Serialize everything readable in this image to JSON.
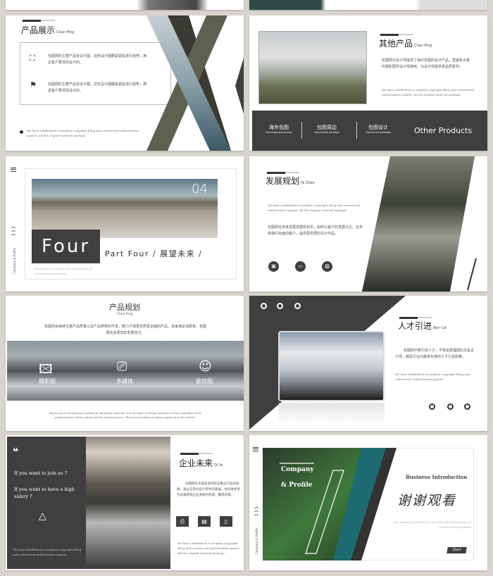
{
  "slides": {
    "s1": {
      "title": "产品展示",
      "sub": "Chan Ping",
      "item1": "包图网的主要产品有设计图，这些设计图都紧紧贴流行趋势，满足客户要求而设计的。",
      "item2": "包图网的主要产品有设计图，这些设计图都紧紧贴流行趋势，满足客户要求而设计的。",
      "footer": "We have established a complete copyright filing and commercial authorization system. All the original material package"
    },
    "s2": {
      "title": "其他产品",
      "sub": "Chan Ping",
      "body": "包图网为设计师提供了海外包图的设计产品，里面有大量的摄影图供设计师使用，为设计师提供高品质素材。",
      "footer": "We have established a complete copyright filing and commercial authorization system. All the original material package",
      "tabs": [
        {
          "label": "海外包图",
          "sub": "Sea outsourcing map"
        },
        {
          "label": "包图周边",
          "sub": "Around the package"
        },
        {
          "label": "包图设计",
          "sub": "Around the package"
        }
      ],
      "other": "Other Products"
    },
    "s3": {
      "num": "04",
      "big": "Four",
      "part": "Part Four / 展望未来 /",
      "intro": "Introduction includes the introduction of commercial promotion",
      "side": "Company & Profile"
    },
    "s4": {
      "title": "发展规划",
      "sub": "Fa Zhan",
      "footer": "We have established a complete copyright filing and commercial authorization system. All the original material package",
      "body": "包图网在未来发展发展规划中，始终以客户的发展为主，在未来我们会面向客户，提供更优质的设计作品。"
    },
    "s5": {
      "title": "产品规划",
      "sub": "Chan Ping",
      "body": "包图网会继续注重产品质量以及产品种类的开发，致力于做更优质更全面的产品，未来满足消费者，包图网还会更加的发展自己。",
      "icons": [
        "摄影图",
        "多媒体",
        "装饰图"
      ],
      "footer": "Ibaotu.com is a professional website for designing materials. It is the leader of design websites in China regardless of the professionalism of the website and the activity of users. There are countless members registered on the website."
    },
    "s6": {
      "title": "人才引进",
      "sub": "Ren Cai",
      "body": "包图网不断引进人才，不管是管理团队还是设计师，都是行业内最高标准的人才引进政策。",
      "footer": "We have established a complete copyright filing and commercial authorization system."
    },
    "s7": {
      "q1": "If you want to join us ?",
      "q2": "If you want to have a high salary ?",
      "footer_left": "We have established a complete copyright filing and commercial authorization system",
      "title": "企业未来",
      "sub": "Qi Ye",
      "body": "包图网在未来还会持续注重设计层的发展，通过与签约设计师共同发展，共同进步的方式来获得企业发展的机遇，赢得未来。",
      "footer": "We have established a complete copyright filing and commercial authorization system. All the original material package"
    },
    "s8": {
      "company": "Company",
      "profile": "& Profile",
      "biz": "Business Introduction",
      "thanks": "谢谢观看",
      "intro": "The company introduction includes the introduction of commercial promotion",
      "start": "Start",
      "side": "Company & Profile"
    }
  },
  "colors": {
    "dark": "#3f3f3f",
    "background": "#d8d4ce",
    "teal": "#1d6b70"
  }
}
